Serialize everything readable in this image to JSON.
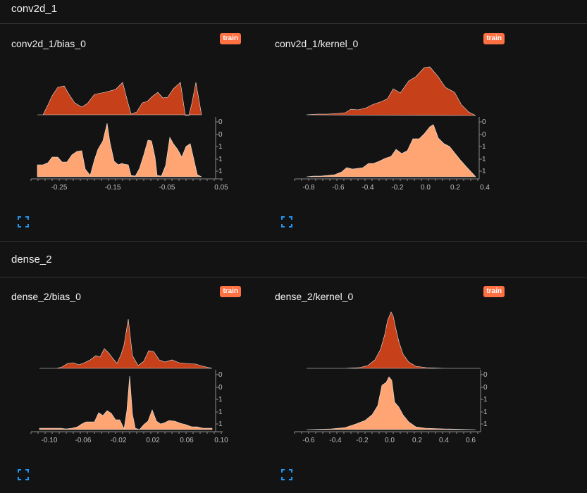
{
  "sections": [
    {
      "title": "conv2d_1",
      "cards": [
        {
          "title": "conv2d_1/bias_0",
          "run_label": "train",
          "x_ticks": [
            "-0.25",
            "-0.15",
            "-0.05",
            "0.05"
          ],
          "y_ticks": [
            "0",
            "0",
            "1",
            "1",
            "1"
          ]
        },
        {
          "title": "conv2d_1/kernel_0",
          "run_label": "train",
          "x_ticks": [
            "-0.8",
            "-0.6",
            "-0.4",
            "-0.2",
            "0.0",
            "0.2",
            "0.4"
          ],
          "y_ticks": [
            "0",
            "0",
            "1",
            "1",
            "1"
          ]
        }
      ]
    },
    {
      "title": "dense_2",
      "cards": [
        {
          "title": "dense_2/bias_0",
          "run_label": "train",
          "x_ticks": [
            "-0.10",
            "-0.06",
            "-0.02",
            "0.02",
            "0.06",
            "0.10"
          ],
          "y_ticks": [
            "0",
            "0",
            "1",
            "1",
            "1"
          ]
        },
        {
          "title": "dense_2/kernel_0",
          "run_label": "train",
          "x_ticks": [
            "-0.6",
            "-0.4",
            "-0.2",
            "0.0",
            "0.2",
            "0.4",
            "0.6"
          ],
          "y_ticks": [
            "0",
            "0",
            "1",
            "1",
            "1"
          ]
        }
      ]
    }
  ],
  "icons": {
    "expand": "fullscreen-expand-icon"
  },
  "colors": {
    "background": "#131313",
    "early_step": "#c6401a",
    "late_step": "#ffa574",
    "run_badge": "#ff7043",
    "expand_icon": "#2196f3"
  }
}
